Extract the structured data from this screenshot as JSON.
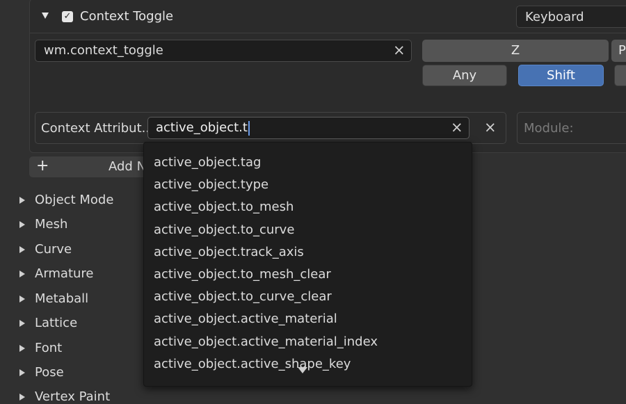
{
  "item": {
    "title": "Context Toggle",
    "input_type": "Keyboard"
  },
  "operator": {
    "value": "wm.context_toggle",
    "clear_icon": "×"
  },
  "key": {
    "value": "Z",
    "next_partial": "P"
  },
  "modifiers": [
    {
      "label": "Any",
      "active": false
    },
    {
      "label": "Shift",
      "active": true
    }
  ],
  "context": {
    "label": "Context Attribut...",
    "value": "active_object.t",
    "clear_icon": "×",
    "module_placeholder": "Module:"
  },
  "add_button": {
    "icon": "+",
    "label": "Add N"
  },
  "categories": [
    "Object Mode",
    "Mesh",
    "Curve",
    "Armature",
    "Metaball",
    "Lattice",
    "Font",
    "Pose",
    "Vertex Paint"
  ],
  "suggestions": [
    "active_object.tag",
    "active_object.type",
    "active_object.to_mesh",
    "active_object.to_curve",
    "active_object.track_axis",
    "active_object.to_mesh_clear",
    "active_object.to_curve_clear",
    "active_object.active_material",
    "active_object.active_material_index",
    "active_object.active_shape_key"
  ],
  "colors": {
    "accent": "#4772b3",
    "background": "#303030",
    "popup": "#1e1e1e"
  }
}
